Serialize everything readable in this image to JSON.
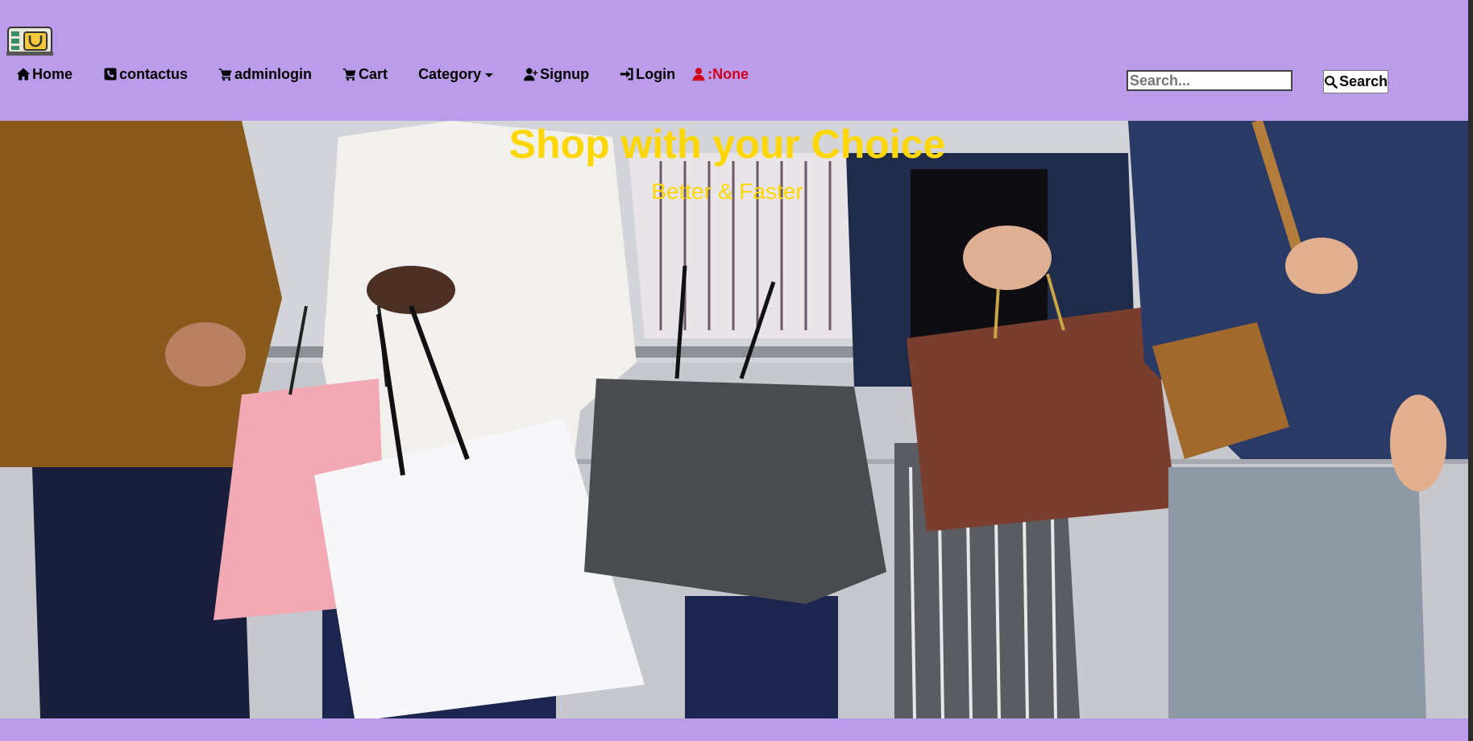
{
  "nav": {
    "logo_icon": "shop-logo-icon",
    "items": [
      {
        "label": "Home",
        "icon": "home-icon"
      },
      {
        "label": "contactus",
        "icon": "phone-icon"
      },
      {
        "label": "adminlogin",
        "icon": "cart-icon"
      },
      {
        "label": "Cart",
        "icon": "cart-icon"
      },
      {
        "label": "Category",
        "icon": "caret-down-icon"
      },
      {
        "label": "Signup",
        "icon": "user-plus-icon"
      },
      {
        "label": "Login",
        "icon": "sign-in-icon"
      }
    ],
    "user_label": ":None",
    "user_color": "#d0021b"
  },
  "search": {
    "placeholder": "Search...",
    "value": "",
    "button_label": "Search"
  },
  "hero": {
    "title": "Shop with your Choice",
    "subtitle": "Better & Faster",
    "text_color": "#ffd700"
  },
  "colors": {
    "navbar_bg": "#bb9ceb"
  }
}
